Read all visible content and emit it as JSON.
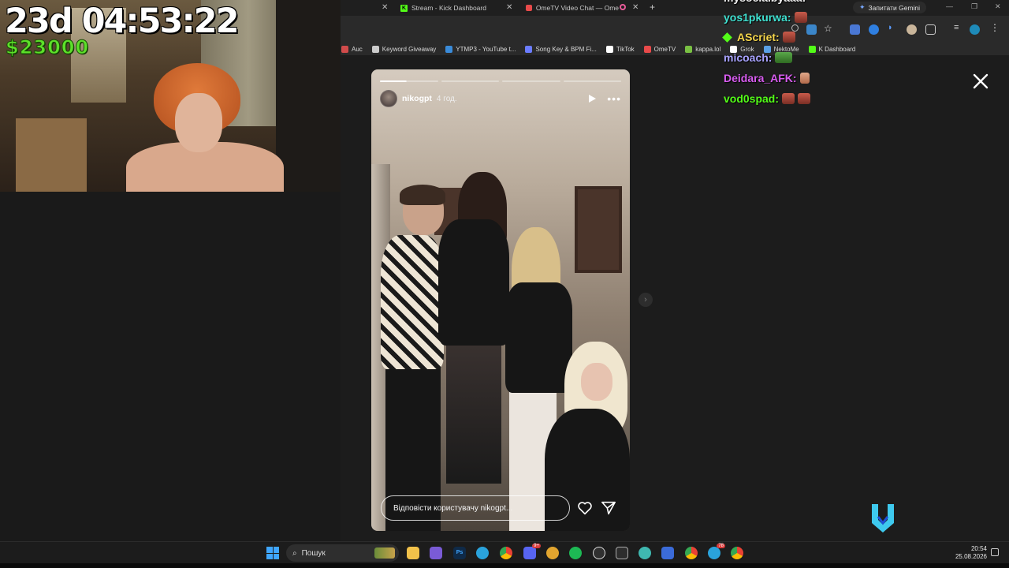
{
  "overlay": {
    "timer": "23d 04:53:22",
    "money": "$23000"
  },
  "browser": {
    "tabs": [
      {
        "label": "Stream - Kick Dashboard"
      },
      {
        "label": "OmeTV Video Chat — Ome"
      }
    ],
    "new_tab": "+",
    "gemini_button": "Запитати Gemini",
    "bookmarks": [
      {
        "label": "Auc",
        "color": "#d04b4b"
      },
      {
        "label": "Keyword Giveaway",
        "color": "#cccccc"
      },
      {
        "label": "YTMP3 - YouTube t...",
        "color": "#3a8bd9"
      },
      {
        "label": "Song Key & BPM Fi...",
        "color": "#6b7cff"
      },
      {
        "label": "TikTok",
        "color": "#ffffff"
      },
      {
        "label": "OmeTV",
        "color": "#e84a4a"
      },
      {
        "label": "kappa.lol",
        "color": "#79c043"
      },
      {
        "label": "Grok",
        "color": "#ffffff"
      },
      {
        "label": "NektoMe",
        "color": "#5aa0e6"
      },
      {
        "label": "K Dashboard",
        "color": "#53fc18"
      }
    ]
  },
  "story": {
    "username": "nikogpt",
    "time_ago": "4 год.",
    "reply_placeholder": "Відповісти користувачу nikogpt..."
  },
  "chat": {
    "messages": [
      {
        "user": "yos1pkurwa:",
        "color": "#3fe0d0"
      },
      {
        "user": "AScriet:",
        "color": "#f5d54a"
      },
      {
        "user": "micoach:",
        "color": "#a9a3ff"
      },
      {
        "user": "Deidara_AFK:",
        "color": "#d85cf0"
      },
      {
        "user": "vod0spad:",
        "color": "#53fc18"
      }
    ]
  },
  "taskbar": {
    "search_placeholder": "Пошук",
    "time": "20:54",
    "date": "25.08.2026",
    "badges": {
      "discord": "9+",
      "telegram": "78"
    }
  },
  "colors": {
    "kick_green": "#53fc18",
    "money_green": "#5de02a",
    "accent_blue": "#3fa6ff"
  }
}
